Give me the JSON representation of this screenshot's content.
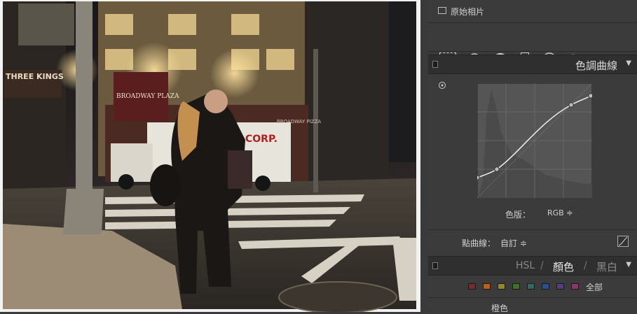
{
  "panel": {
    "original_photo_label": "原始相片",
    "tone_curve": {
      "title": "色調曲線",
      "channel_label": "色版：",
      "channel_value": "RGB ≑",
      "point_curve_label": "點曲線：",
      "point_curve_value": "自訂 ≑"
    },
    "hsl": {
      "tab_hsl": "HSL",
      "sep1": "/",
      "tab_color": "顏色",
      "sep2": "/",
      "tab_bw": "黑白",
      "all_label": "全部",
      "selected_color_label": "橙色",
      "swatches": [
        {
          "name": "red",
          "color": "#7a2a2a"
        },
        {
          "name": "orange",
          "color": "#b8601c"
        },
        {
          "name": "yellow",
          "color": "#8f8a25"
        },
        {
          "name": "green",
          "color": "#3f6f2e"
        },
        {
          "name": "aqua",
          "color": "#2f6b64"
        },
        {
          "name": "blue",
          "color": "#2a4f8c"
        },
        {
          "name": "purple",
          "color": "#563d8a"
        },
        {
          "name": "magenta",
          "color": "#8a3a6a"
        }
      ]
    }
  },
  "photo": {
    "sign_three_kings": "THREE KINGS",
    "sign_broadway_plaza": "BROADWAY PLAZA",
    "sign_corp": "CORP.",
    "sign_broadway_pizza": "BROADWAY PIZZA"
  }
}
